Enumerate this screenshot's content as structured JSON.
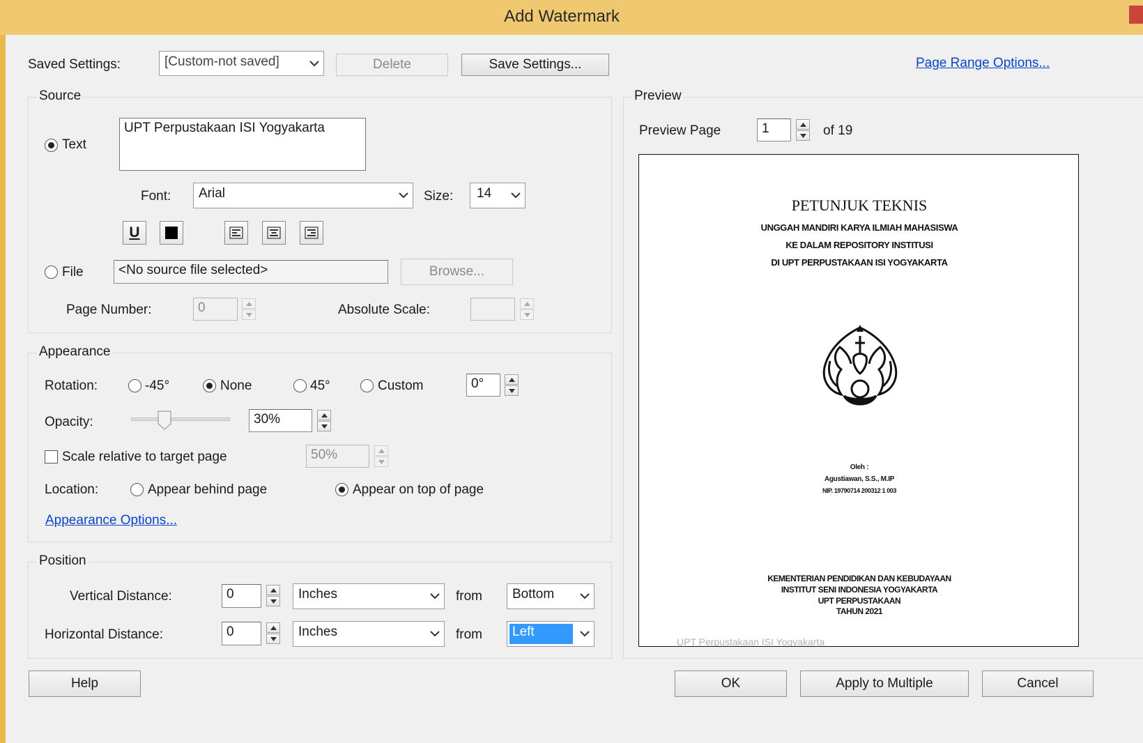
{
  "window": {
    "title": "Add Watermark"
  },
  "saved_settings": {
    "label": "Saved Settings:",
    "value": "[Custom-not saved]",
    "delete_label": "Delete",
    "save_label": "Save Settings...",
    "page_range_link": "Page Range Options..."
  },
  "source": {
    "legend": "Source",
    "text_option": "Text",
    "text_value": "UPT Perpustakaan ISI Yogyakarta",
    "font_label": "Font:",
    "font_value": "Arial",
    "size_label": "Size:",
    "size_value": "14",
    "file_option": "File",
    "file_value": "<No source file selected>",
    "browse_label": "Browse...",
    "page_number_label": "Page Number:",
    "page_number_value": "0",
    "absolute_scale_label": "Absolute Scale:",
    "absolute_scale_value": ""
  },
  "appearance": {
    "legend": "Appearance",
    "rotation_label": "Rotation:",
    "rot_neg45": "-45°",
    "rot_none": "None",
    "rot_45": "45°",
    "rot_custom": "Custom",
    "rot_custom_value": "0°",
    "opacity_label": "Opacity:",
    "opacity_value": "30%",
    "opacity_level": 0.3,
    "scale_label": "Scale relative to target page",
    "scale_value": "50%",
    "location_label": "Location:",
    "behind_label": "Appear behind page",
    "ontop_label": "Appear on top of page",
    "options_link": "Appearance Options..."
  },
  "position": {
    "legend": "Position",
    "vertical_label": "Vertical Distance:",
    "vertical_value": "0",
    "vertical_unit": "Inches",
    "vertical_from_label": "from",
    "vertical_from": "Bottom",
    "horizontal_label": "Horizontal Distance:",
    "horizontal_value": "0",
    "horizontal_unit": "Inches",
    "horizontal_from_label": "from",
    "horizontal_from": "Left"
  },
  "preview": {
    "legend": "Preview",
    "page_label": "Preview Page",
    "page_value": "1",
    "of_label": "of 19",
    "doc": {
      "title": "PETUNJUK TEKNIS",
      "sub1": "UNGGAH MANDIRI KARYA ILMIAH MAHASISWA",
      "sub2": "KE DALAM REPOSITORY INSTITUSI",
      "sub3": "DI UPT PERPUSTAKAAN ISI YOGYAKARTA",
      "oleh": "Oleh :",
      "author": "Agustiawan, S.S., M.IP",
      "nip": "NIP. 19790714 200312 1 003",
      "footer1": "KEMENTERIAN PENDIDIKAN DAN KEBUDAYAAN",
      "footer2": "INSTITUT SENI INDONESIA YOGYAKARTA",
      "footer3": "UPT PERPUSTAKAAN",
      "footer4": "TAHUN 2021",
      "watermark": "UPT Perpustakaan ISI Yogyakarta"
    }
  },
  "buttons": {
    "help": "Help",
    "ok": "OK",
    "apply_multiple": "Apply to Multiple",
    "cancel": "Cancel"
  },
  "colors": {
    "title_bar": "#f0c870",
    "link": "#0645c8",
    "selection": "#3399ff"
  }
}
